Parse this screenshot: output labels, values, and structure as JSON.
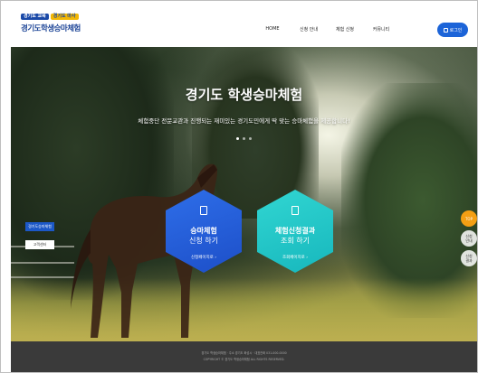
{
  "header": {
    "logo_badge_1": "경기도 교육",
    "logo_badge_2": "경기도 마사",
    "logo_title": "경기도학생승마체험",
    "nav": [
      "HOME",
      "신청 안내",
      "체험 신청",
      "커뮤니티"
    ],
    "login_label": "로그인"
  },
  "hero": {
    "title": "경기도 학생승마체험",
    "subtitle": "체험중단 전문교관과 진행되는 재미있는 경기도민에게 딱 맞는 승마체험을 제공합니다!",
    "slide_count": 3,
    "active_slide": 1,
    "cards": [
      {
        "line1": "승마체험",
        "line2": "신청 하기",
        "link": "신청페이지로 ›",
        "color": "#1d4fc8"
      },
      {
        "line1": "체험신청결과",
        "line2": "조회 하기",
        "link": "조회페이지로 ›",
        "color": "#17b7bd"
      }
    ],
    "side_menu": [
      "경기도승마체험",
      "고객센터"
    ],
    "quick_buttons": [
      "TOP",
      "신청\n안내",
      "신청\n결과"
    ]
  },
  "footer": {
    "line1": "경기도 학생승마체험 · 주소 경기도 화성시 · 대표전화 031-000-0000",
    "line2": "COPYRIGHT © 경기도 학생승마체험 ALL RIGHTS RESERVED."
  }
}
